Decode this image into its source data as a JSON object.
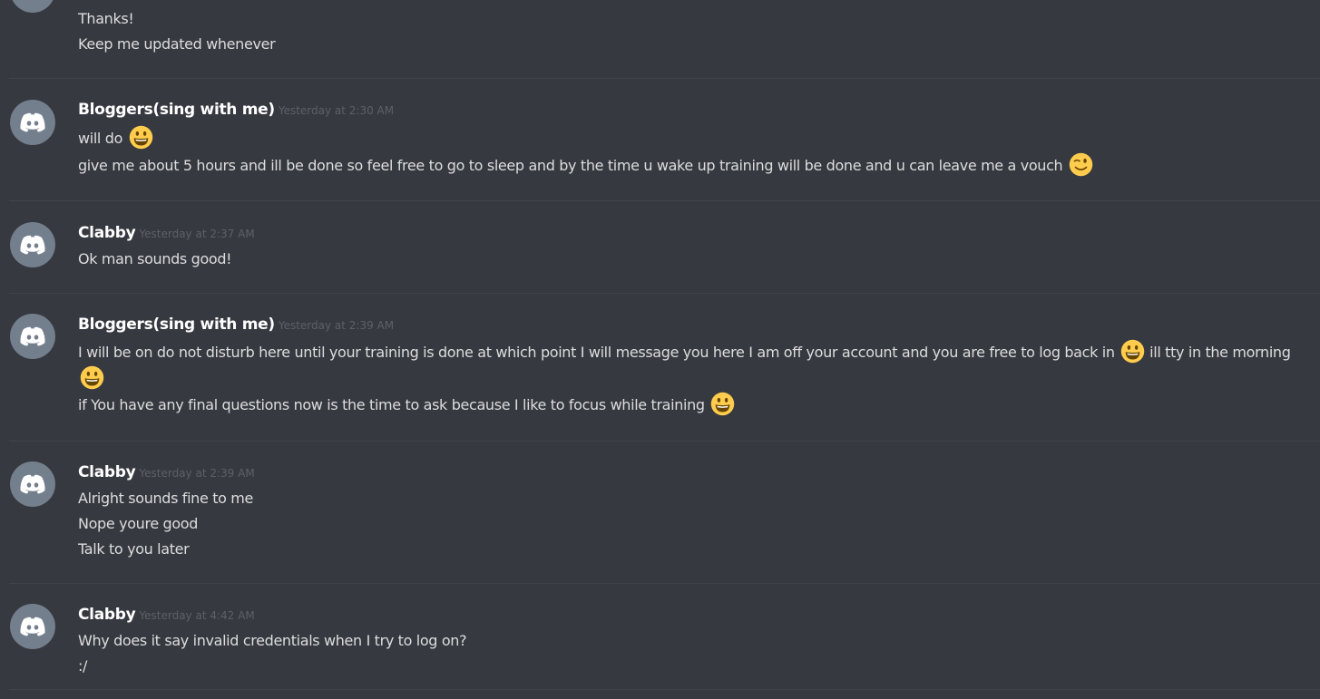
{
  "messages": [
    {
      "lines": [
        "Thanks!",
        "Keep me updated whenever"
      ]
    },
    {
      "username": "Bloggers(sing with me)",
      "timestamp": "Yesterday at 2:30 AM",
      "lines": [
        "will do",
        "give me about 5 hours and ill be done so feel free to go to sleep and by the time u wake up training will be done and u can leave me a vouch"
      ],
      "emojis": [
        "grinning-face-emoji",
        "winking-face-emoji"
      ]
    },
    {
      "username": "Clabby",
      "timestamp": "Yesterday at 2:37 AM",
      "lines": [
        "Ok man sounds good!"
      ]
    },
    {
      "username": "Bloggers(sing with me)",
      "timestamp": "Yesterday at 2:39 AM",
      "lines": [
        "I will be on do not disturb here until your training is done at which point I will message you here I am off your account and you are free to log back in",
        "ill tty in the morning",
        "if You have any final questions now is the time to ask because I like to focus while training"
      ],
      "emojis": [
        "grinning-face-emoji",
        "grinning-face-emoji",
        "grinning-face-emoji"
      ]
    },
    {
      "username": "Clabby",
      "timestamp": "Yesterday at 2:39 AM",
      "lines": [
        "Alright sounds fine to me",
        "Nope youre good",
        "Talk to you later"
      ]
    },
    {
      "username": "Clabby",
      "timestamp": "Yesterday at 4:42 AM",
      "lines": [
        "Why does it say invalid credentials when I try to log on?",
        ":/"
      ]
    }
  ],
  "colors": {
    "background": "#36393f",
    "avatar": "#747f8d",
    "text": "#dcddde",
    "username": "#ffffff",
    "timestamp": "#5d6167",
    "emoji": "#ffcc4d"
  }
}
